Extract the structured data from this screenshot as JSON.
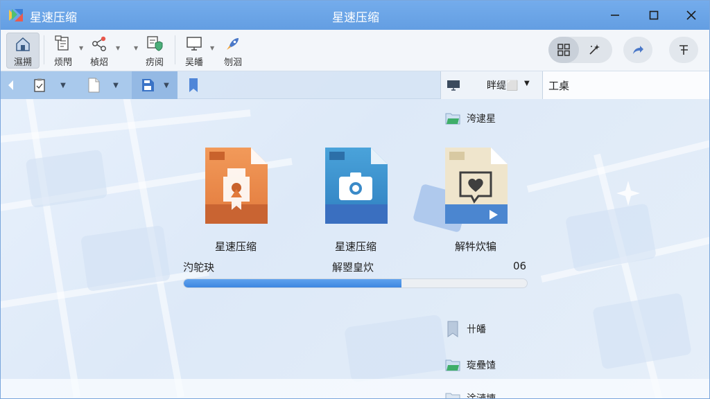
{
  "app": {
    "name": "星速压缩",
    "window_title": "星速压缩"
  },
  "colors": {
    "titlebar": "#6aa4e6",
    "accent": "#3d86e0",
    "orange_card": "#ee8a4c",
    "blue_card": "#3f93cf",
    "beige_card": "#ede3c9"
  },
  "toolbar": {
    "items": [
      {
        "label": "濕搠",
        "icon": "home-icon"
      },
      {
        "label": "烦閇",
        "icon": "document-add-icon"
      },
      {
        "label": "楨炤",
        "icon": "share-icon"
      },
      {
        "label": "疠阅",
        "icon": "shield-check-icon"
      },
      {
        "label": "吴皤",
        "icon": "monitor-icon"
      },
      {
        "label": "刎洄",
        "icon": "rocket-icon"
      }
    ],
    "right_buttons": [
      "grid-view-icon",
      "magic-icon",
      "share-arrow-icon",
      "settings-icon"
    ]
  },
  "addressbar": {
    "view_label": "眫缇⬜",
    "search_value": "工桌"
  },
  "files": [
    {
      "name": "星速压缩",
      "icon": "orange-archive-icon"
    },
    {
      "name": "星速压缩",
      "icon": "camera-file-icon"
    },
    {
      "name": "解牪炊犏",
      "icon": "video-file-icon"
    }
  ],
  "progress": {
    "left_label": "汋鸵玦",
    "center_label": "解曌皇炊",
    "value_label": "06",
    "fraction": 0.635
  },
  "side_items": [
    {
      "label": "洿逮星",
      "icon": "green-folder-icon"
    },
    {
      "label": "卄皤",
      "icon": "bookmark-icon"
    },
    {
      "label": "琁疉馇",
      "icon": "green-folder-icon"
    },
    {
      "label": "淦漣埬",
      "icon": "folder-icon"
    }
  ]
}
